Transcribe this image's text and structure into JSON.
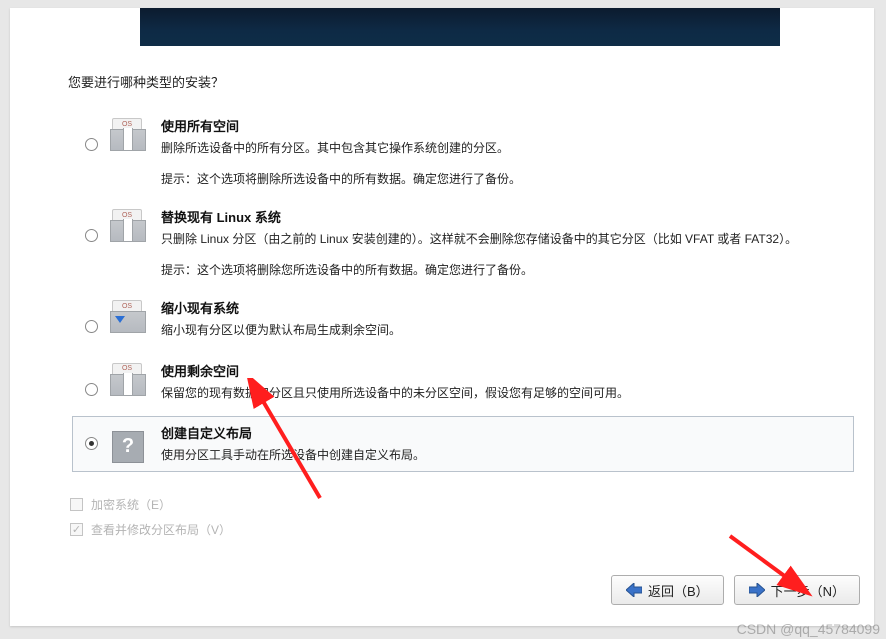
{
  "prompt": "您要进行哪种类型的安装？",
  "options": [
    {
      "id": "use-all-space",
      "title": "使用所有空间",
      "desc": "删除所选设备中的所有分区。其中包含其它操作系统创建的分区。",
      "hint": "提示：这个选项将删除所选设备中的所有数据。确定您进行了备份。",
      "icon": "drive-os-gap",
      "selected": false
    },
    {
      "id": "replace-linux",
      "title": "替换现有 Linux 系统",
      "desc": "只删除 Linux 分区（由之前的 Linux 安装创建的）。这样就不会删除您存储设备中的其它分区（比如 VFAT 或者 FAT32）。",
      "hint": "提示：这个选项将删除您所选设备中的所有数据。确定您进行了备份。",
      "icon": "drive-os-gap",
      "selected": false
    },
    {
      "id": "shrink",
      "title": "缩小现有系统",
      "desc": "缩小现有分区以便为默认布局生成剩余空间。",
      "hint": "",
      "icon": "drive-os-arrow",
      "selected": false
    },
    {
      "id": "use-free",
      "title": "使用剩余空间",
      "desc": "保留您的现有数据和分区且只使用所选设备中的未分区空间，假设您有足够的空间可用。",
      "hint": "",
      "icon": "drive-os-gap",
      "selected": false
    },
    {
      "id": "custom",
      "title": "创建自定义布局",
      "desc": "使用分区工具手动在所选设备中创建自定义布局。",
      "hint": "",
      "icon": "question",
      "selected": true
    }
  ],
  "checkboxes": {
    "encrypt": {
      "label": "加密系统（E）",
      "checked": false,
      "enabled": false
    },
    "review": {
      "label": "查看并修改分区布局（V）",
      "checked": true,
      "enabled": false
    }
  },
  "nav": {
    "back": "返回（B）",
    "next": "下一步（N）"
  },
  "watermark": "CSDN @qq_45784099"
}
